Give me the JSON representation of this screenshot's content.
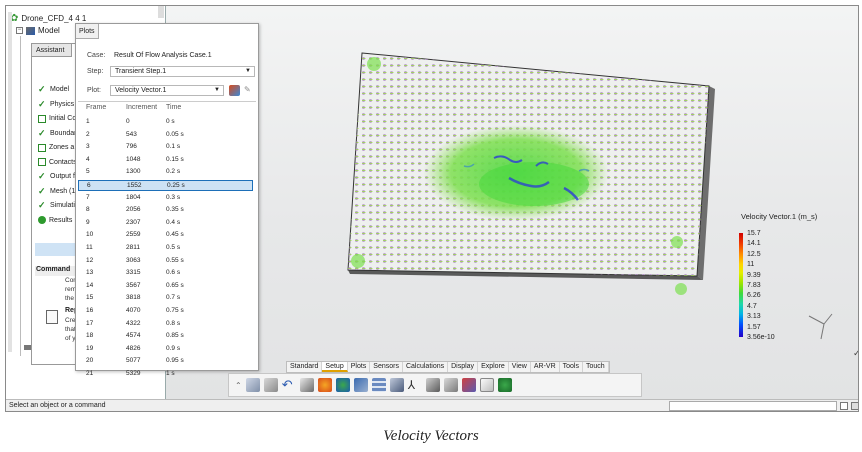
{
  "tree": {
    "root_label": "Drone_CFD_4 4 1",
    "model_label": "Model"
  },
  "assistant": {
    "tab_label": "Assistant",
    "items": [
      {
        "label": "Model",
        "state": "done"
      },
      {
        "label": "Physics",
        "state": "done"
      },
      {
        "label": "Initial Co",
        "state": "todo"
      },
      {
        "label": "Boundar",
        "state": "done"
      },
      {
        "label": "Zones a",
        "state": "todo"
      },
      {
        "label": "Contacts",
        "state": "todo"
      },
      {
        "label": "Output f",
        "state": "done"
      },
      {
        "label": "Mesh (1",
        "state": "done"
      },
      {
        "label": "Simulati",
        "state": "done"
      },
      {
        "label": "Results",
        "state": "active"
      }
    ],
    "commands_label": "Command",
    "commands_lines": [
      "Cont",
      "remo",
      "the r"
    ],
    "report_label": "Repo",
    "report_lines": [
      "Crea",
      "that",
      "of yo"
    ]
  },
  "plots": {
    "tab_label": "Plots",
    "case_label": "Case:",
    "case_value": "Result Of Flow Analysis Case.1",
    "step_label": "Step:",
    "step_value": "Transient Step.1",
    "plot_label": "Plot:",
    "plot_value": "Velocity Vector.1",
    "columns": [
      "Frame",
      "Increment",
      "Time"
    ],
    "selected_frame": 6,
    "rows": [
      [
        "1",
        "0",
        "0 s"
      ],
      [
        "2",
        "543",
        "0.05 s"
      ],
      [
        "3",
        "796",
        "0.1 s"
      ],
      [
        "4",
        "1048",
        "0.15 s"
      ],
      [
        "5",
        "1300",
        "0.2 s"
      ],
      [
        "6",
        "1552",
        "0.25 s"
      ],
      [
        "7",
        "1804",
        "0.3 s"
      ],
      [
        "8",
        "2056",
        "0.35 s"
      ],
      [
        "9",
        "2307",
        "0.4 s"
      ],
      [
        "10",
        "2559",
        "0.45 s"
      ],
      [
        "11",
        "2811",
        "0.5 s"
      ],
      [
        "12",
        "3063",
        "0.55 s"
      ],
      [
        "13",
        "3315",
        "0.6 s"
      ],
      [
        "14",
        "3567",
        "0.65 s"
      ],
      [
        "15",
        "3818",
        "0.7 s"
      ],
      [
        "16",
        "4070",
        "0.75 s"
      ],
      [
        "17",
        "4322",
        "0.8 s"
      ],
      [
        "18",
        "4574",
        "0.85 s"
      ],
      [
        "19",
        "4826",
        "0.9 s"
      ],
      [
        "20",
        "5077",
        "0.95 s"
      ],
      [
        "21",
        "5329",
        "1 s"
      ]
    ]
  },
  "toolbar": {
    "tabs": [
      "Standard",
      "Setup",
      "Plots",
      "Sensors",
      "Calculations",
      "Display",
      "Explore",
      "View",
      "AR-VR",
      "Tools",
      "Touch"
    ],
    "active_tab": "Setup"
  },
  "legend": {
    "title": "Velocity Vector.1 (m_s)",
    "values": [
      "15.7",
      "14.1",
      "12.5",
      "11",
      "9.39",
      "7.83",
      "6.26",
      "4.7",
      "3.13",
      "1.57",
      "3.56e-10"
    ],
    "colors": [
      "#d10000",
      "#ff8a00",
      "#e6ef00",
      "#3fd93b",
      "#00b4e6",
      "#2200c8"
    ]
  },
  "status": {
    "text": "Select an object or a command"
  },
  "caption": "Velocity Vectors"
}
